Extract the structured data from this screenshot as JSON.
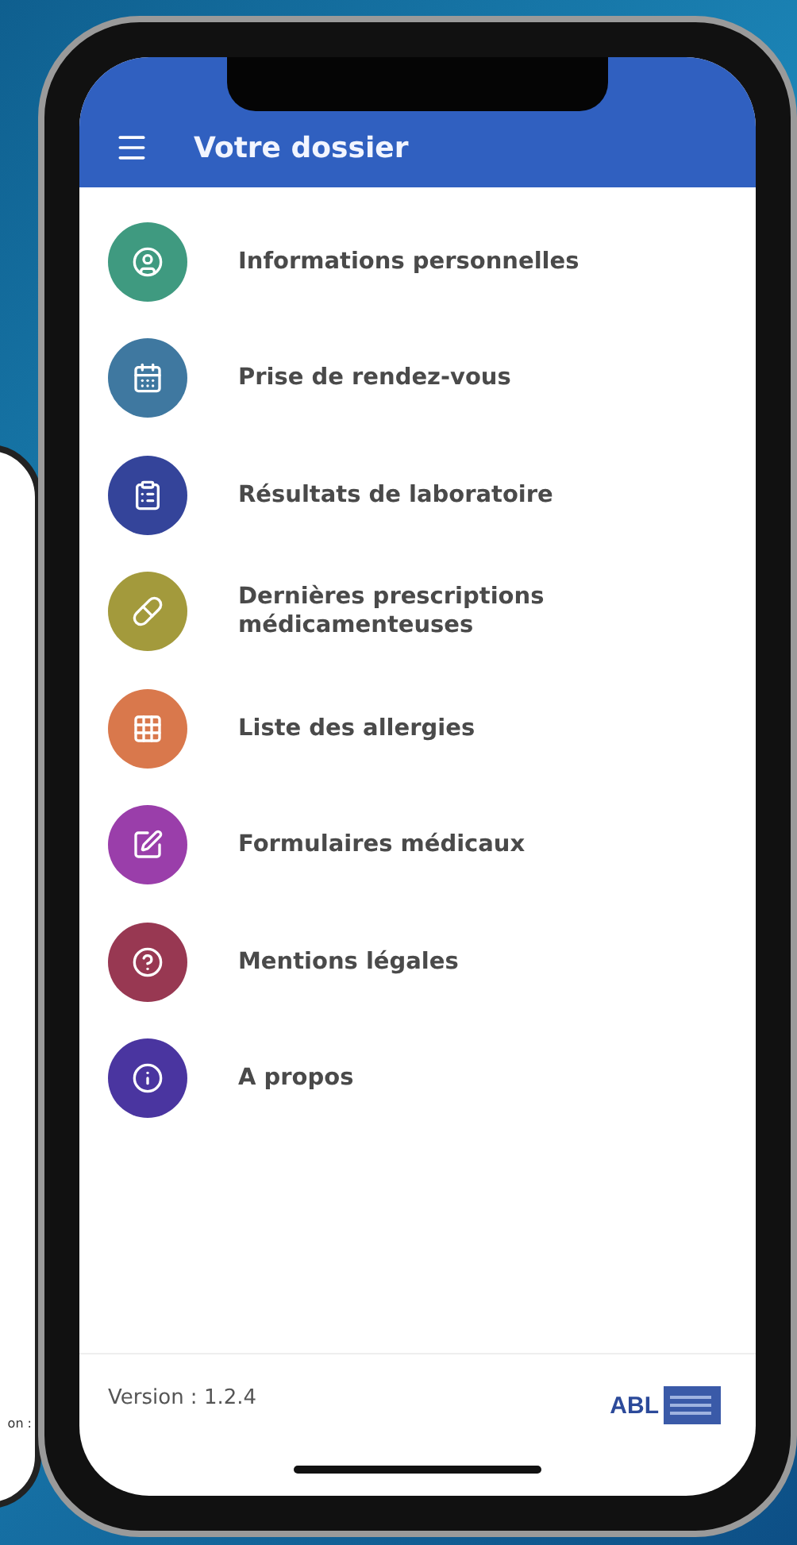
{
  "background_phone": {
    "partial_text": "on :"
  },
  "app_bar": {
    "title": "Votre dossier"
  },
  "menu": [
    {
      "label": "Informations personnelles",
      "color": "#3f9a80"
    },
    {
      "label": "Prise de rendez-vous",
      "color": "#3f78a0"
    },
    {
      "label": "Résultats de laboratoire",
      "color": "#34449a"
    },
    {
      "label": "Dernières prescriptions médicamenteuses",
      "color": "#a39a3c"
    },
    {
      "label": "Liste des allergies",
      "color": "#d9784c"
    },
    {
      "label": "Formulaires médicaux",
      "color": "#9a3eaa"
    },
    {
      "label": "Mentions légales",
      "color": "#983852"
    },
    {
      "label": "A propos",
      "color": "#4a35a0"
    }
  ],
  "footer": {
    "version": "Version : 1.2.4",
    "logo_text": "ABL"
  }
}
